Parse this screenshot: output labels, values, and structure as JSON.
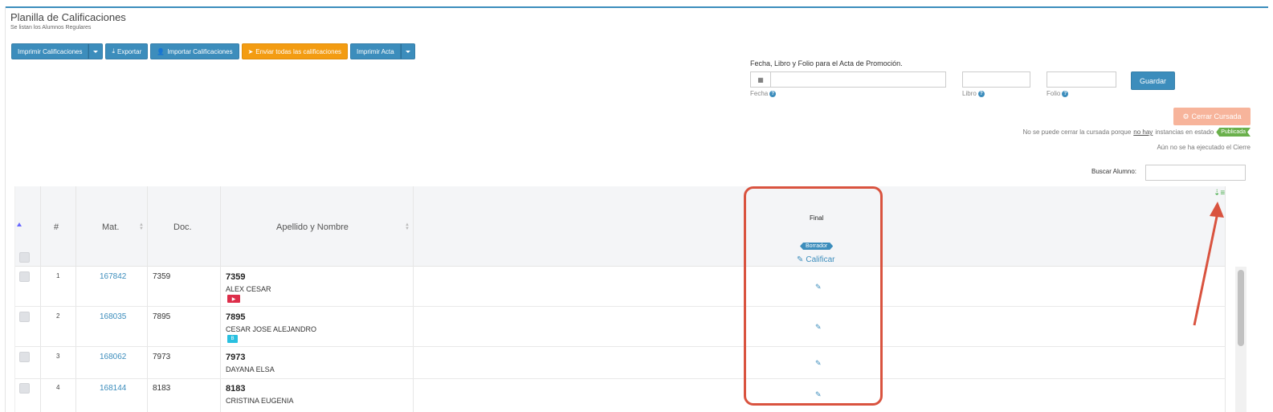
{
  "header": {
    "title": "Planilla de Calificaciones",
    "subtitle": "Se listan los Alumnos Regulares"
  },
  "toolbar": {
    "print_grades": "Imprimir Calificaciones",
    "export": "Exportar",
    "import_grades": "Importar Calificaciones",
    "send_all": "Enviar todas las calificaciones",
    "print_act": "Imprimir Acta"
  },
  "acta": {
    "title": "Fecha, Libro y Folio para el Acta de Promoción.",
    "fecha_label": "Fecha",
    "libro_label": "Libro",
    "folio_label": "Folio",
    "save": "Guardar"
  },
  "cursada": {
    "close_button": "Cerrar Cursada",
    "notice_prefix": "No se puede cerrar la cursada porque",
    "notice_emph": "no hay",
    "notice_suffix": "instancias en estado",
    "status_badge": "Publicada",
    "cierre_notice": "Aún no se ha ejecutado el Cierre"
  },
  "search": {
    "label": "Buscar Alumno:"
  },
  "table": {
    "headers": {
      "num": "#",
      "mat": "Mat.",
      "doc": "Doc.",
      "name": "Apellido y Nombre"
    },
    "final": {
      "title": "Final",
      "status": "Borrador",
      "grade_action": "Calificar"
    },
    "rows": [
      {
        "num": "1",
        "mat": "167842",
        "doc": "7359",
        "id": "7359",
        "name": "ALEX CESAR",
        "badge": "red"
      },
      {
        "num": "2",
        "mat": "168035",
        "doc": "7895",
        "id": "7895",
        "name": "CESAR JOSE ALEJANDRO",
        "badge": "cyan"
      },
      {
        "num": "3",
        "mat": "168062",
        "doc": "7973",
        "id": "7973",
        "name": "DAYANA ELSA",
        "badge": ""
      },
      {
        "num": "4",
        "mat": "168144",
        "doc": "8183",
        "id": "8183",
        "name": "CRISTINA EUGENIA",
        "badge": ""
      }
    ]
  },
  "colors": {
    "primary": "#3c8dbc",
    "warning": "#f39c12",
    "success": "#6ab04c",
    "highlight": "#d9533f"
  }
}
